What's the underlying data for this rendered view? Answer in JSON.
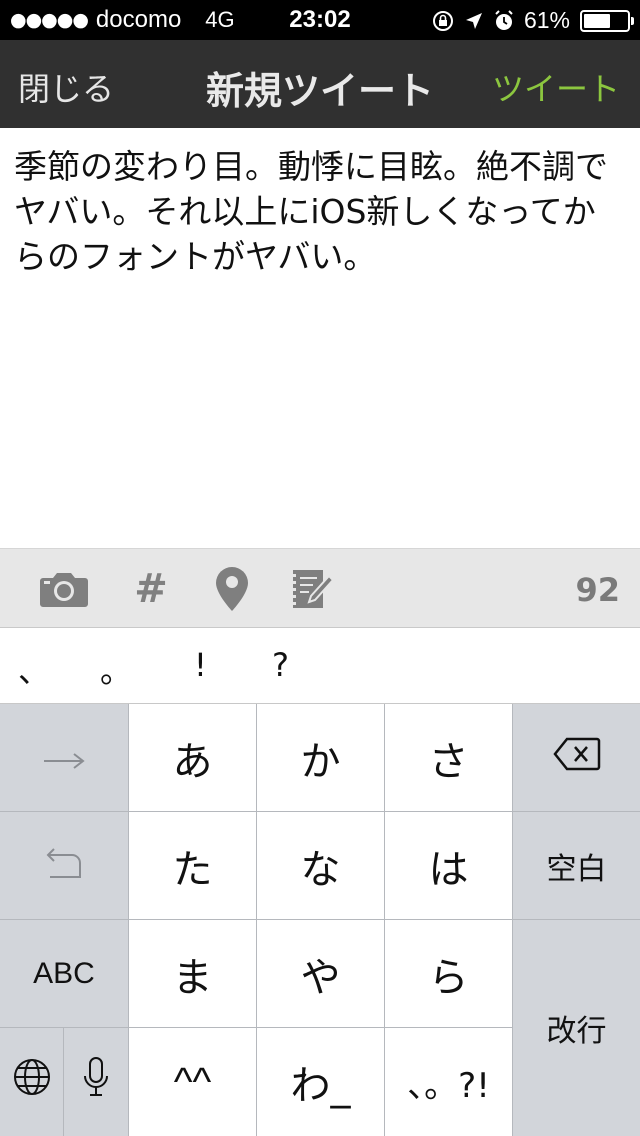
{
  "status_bar": {
    "signal": "●●●●●",
    "carrier": "docomo",
    "network": "4G",
    "time": "23:02",
    "battery_percent": "61%",
    "battery_level": 0.61
  },
  "nav": {
    "close_label": "閉じる",
    "title": "新規ツイート",
    "tweet_label": "ツイート",
    "tweet_color": "#8cc63f"
  },
  "compose": {
    "text": "季節の変わり目。動悸に目眩。絶不調でヤバい。それ以上にiOS新しくなってからのフォントがヤバい。"
  },
  "toolbar": {
    "icons": [
      "camera-icon",
      "hashtag-icon",
      "location-pin-icon",
      "drafts-icon"
    ],
    "hashtag_symbol": "#",
    "remaining_count": "92"
  },
  "candidates": [
    "、",
    "。",
    "!",
    "?"
  ],
  "keyboard": {
    "row1": [
      "あ",
      "か",
      "さ"
    ],
    "row2": [
      "た",
      "な",
      "は"
    ],
    "row3": [
      "ま",
      "や",
      "ら"
    ],
    "row4": [
      "^^",
      "わ_",
      "、。?!"
    ],
    "space_label": "空白",
    "abc_label": "ABC",
    "return_label": "改行",
    "icons": [
      "next-arrow-icon",
      "undo-icon",
      "backspace-icon",
      "globe-icon",
      "microphone-icon"
    ]
  }
}
